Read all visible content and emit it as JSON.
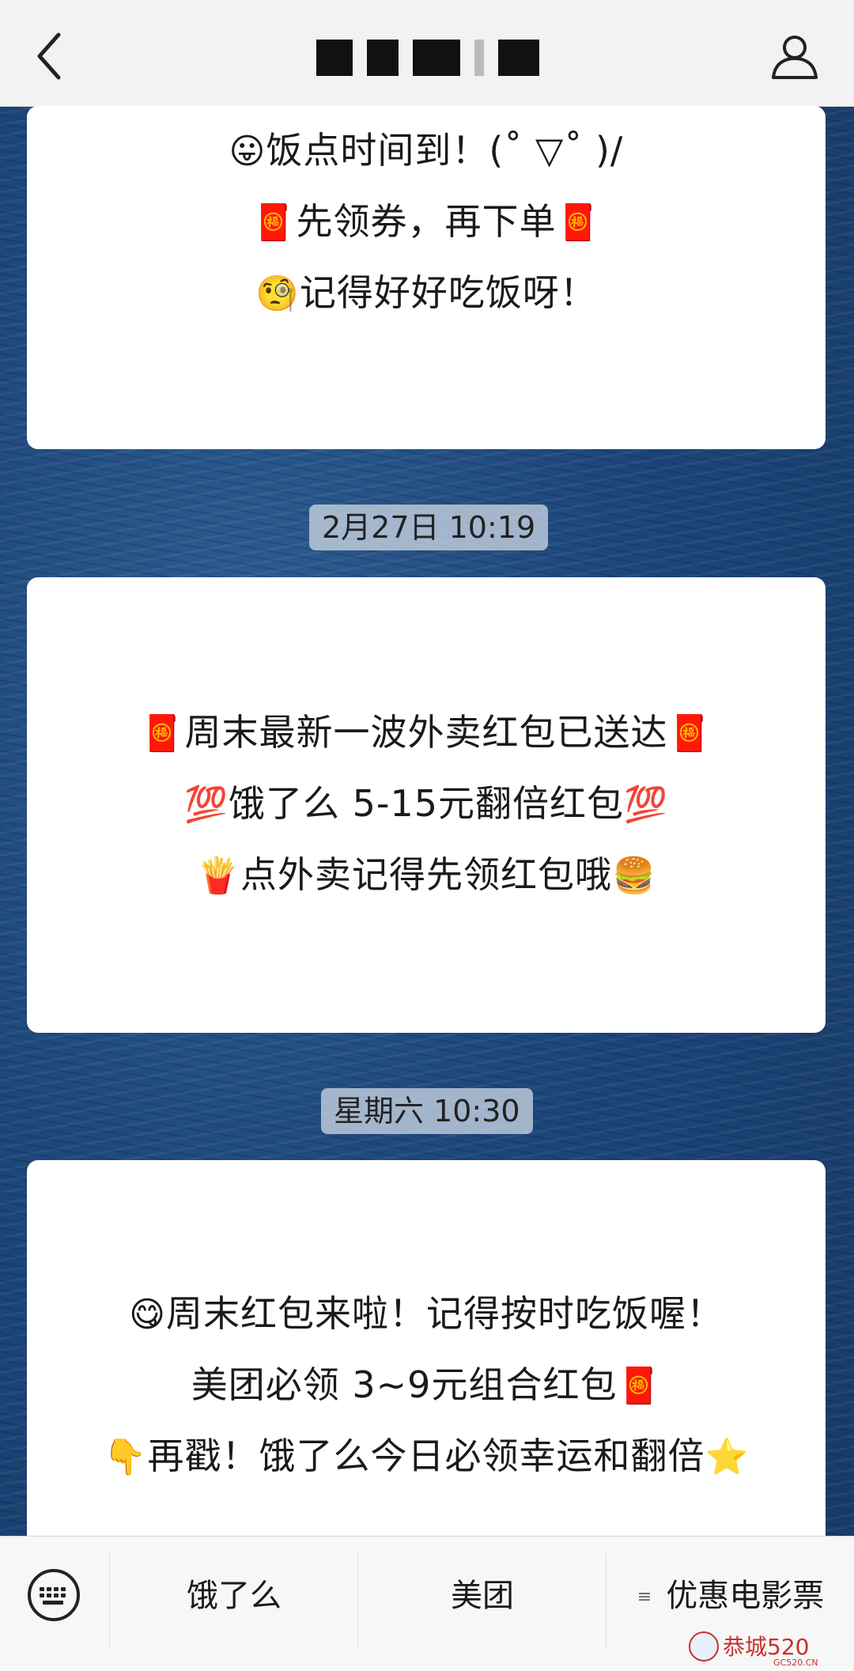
{
  "header": {
    "back_icon": "chevron-left-icon",
    "profile_icon": "person-icon"
  },
  "messages": [
    {
      "lines": [
        {
          "emoji": "😛",
          "text": "饭点时间到！(˚ ▽˚ )/",
          "emoji_end": ""
        },
        {
          "emoji": "🧧",
          "text": "先领券，再下单",
          "emoji_end": "🧧"
        },
        {
          "emoji": "🧐",
          "text": "记得好好吃饭呀！",
          "emoji_end": ""
        }
      ]
    },
    {
      "timestamp": "2月27日 10:19",
      "lines": [
        {
          "emoji": "🧧",
          "text": "周末最新一波外卖红包已送达",
          "emoji_end": "🧧"
        },
        {
          "emoji": "💯",
          "text": "饿了么 5-15元翻倍红包",
          "emoji_end": "💯"
        },
        {
          "emoji": "🍟",
          "text": "点外卖记得先领红包哦",
          "emoji_end": "🍔"
        }
      ]
    },
    {
      "timestamp": "星期六 10:30",
      "lines": [
        {
          "emoji": "😋",
          "text": "周末红包来啦！记得按时吃饭喔！",
          "emoji_end": ""
        },
        {
          "emoji": "",
          "text": "美团必领 3~9元组合红包",
          "emoji_end": "🧧"
        },
        {
          "emoji": "👇",
          "text": "再戳！饿了么今日必领幸运和翻倍",
          "emoji_end": "⭐"
        }
      ]
    }
  ],
  "bottom_menu": {
    "keyboard_icon": "keyboard-icon",
    "items": [
      {
        "label": "饿了么"
      },
      {
        "label": "美团"
      },
      {
        "label": "优惠电影票",
        "submenu_icon": "≡"
      }
    ]
  },
  "watermark": {
    "text": "恭城520",
    "sub": "GC520.CN"
  }
}
